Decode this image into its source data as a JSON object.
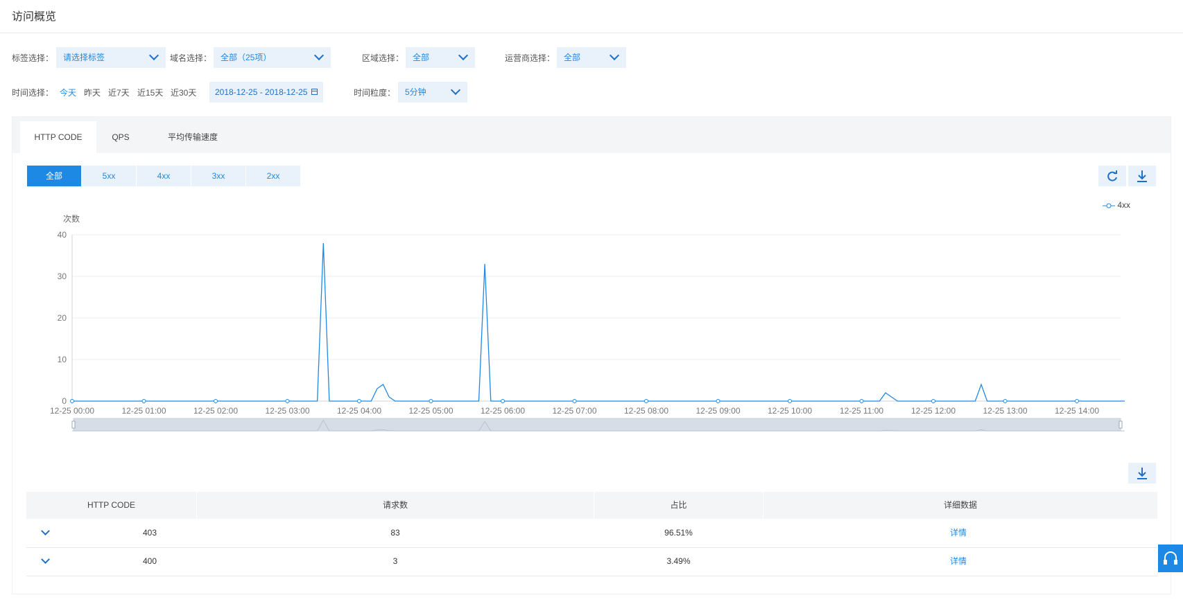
{
  "page": {
    "title": "访问概览"
  },
  "filters": {
    "tag_label": "标签选择：",
    "tag_value": "请选择标签",
    "domain_label": "域名选择：",
    "domain_value": "全部（25项）",
    "region_label": "区域选择：",
    "region_value": "全部",
    "isp_label": "运营商选择：",
    "isp_value": "全部",
    "time_label": "时间选择：",
    "time_options": [
      "今天",
      "昨天",
      "近7天",
      "近15天",
      "近30天"
    ],
    "date_range": "2018-12-25 - 2018-12-25",
    "granularity_label": "时间粒度：",
    "granularity_value": "5分钟"
  },
  "tabs": [
    "HTTP CODE",
    "QPS",
    "平均传输速度"
  ],
  "code_filters": [
    "全部",
    "5xx",
    "4xx",
    "3xx",
    "2xx"
  ],
  "colors": {
    "accent": "#1e88e5",
    "light": "#e9f1fb"
  },
  "icons": {
    "refresh": "refresh-icon",
    "download": "download-icon",
    "calendar": "calendar-icon",
    "support": "headset-icon"
  },
  "chart_data": {
    "type": "line",
    "ylabel": "次数",
    "ylim": [
      0,
      40
    ],
    "yticks": [
      0,
      10,
      20,
      30,
      40
    ],
    "xticks": [
      "12-25 00:00",
      "12-25 01:00",
      "12-25 02:00",
      "12-25 03:00",
      "12-25 04:00",
      "12-25 05:00",
      "12-25 06:00",
      "12-25 07:00",
      "12-25 08:00",
      "12-25 09:00",
      "12-25 10:00",
      "12-25 11:00",
      "12-25 12:00",
      "12-25 13:00",
      "12-25 14:00"
    ],
    "legend_position": "top-right",
    "series": [
      {
        "name": "4xx",
        "color": "#1e88e5",
        "points": [
          [
            "00:00",
            0
          ],
          [
            "03:25",
            0
          ],
          [
            "03:30",
            38
          ],
          [
            "03:35",
            0
          ],
          [
            "04:10",
            0
          ],
          [
            "04:15",
            3
          ],
          [
            "04:20",
            4
          ],
          [
            "04:25",
            1
          ],
          [
            "04:30",
            0
          ],
          [
            "05:40",
            0
          ],
          [
            "05:45",
            33
          ],
          [
            "05:50",
            0
          ],
          [
            "11:15",
            0
          ],
          [
            "11:20",
            2
          ],
          [
            "11:25",
            1
          ],
          [
            "11:30",
            0
          ],
          [
            "12:35",
            0
          ],
          [
            "12:40",
            4
          ],
          [
            "12:45",
            0
          ],
          [
            "14:40",
            0
          ]
        ]
      }
    ]
  },
  "table": {
    "headers": [
      "HTTP CODE",
      "请求数",
      "占比",
      "详细数据"
    ],
    "rows": [
      {
        "code": "403",
        "requests": "83",
        "ratio": "96.51%",
        "detail": "详情"
      },
      {
        "code": "400",
        "requests": "3",
        "ratio": "3.49%",
        "detail": "详情"
      }
    ]
  }
}
